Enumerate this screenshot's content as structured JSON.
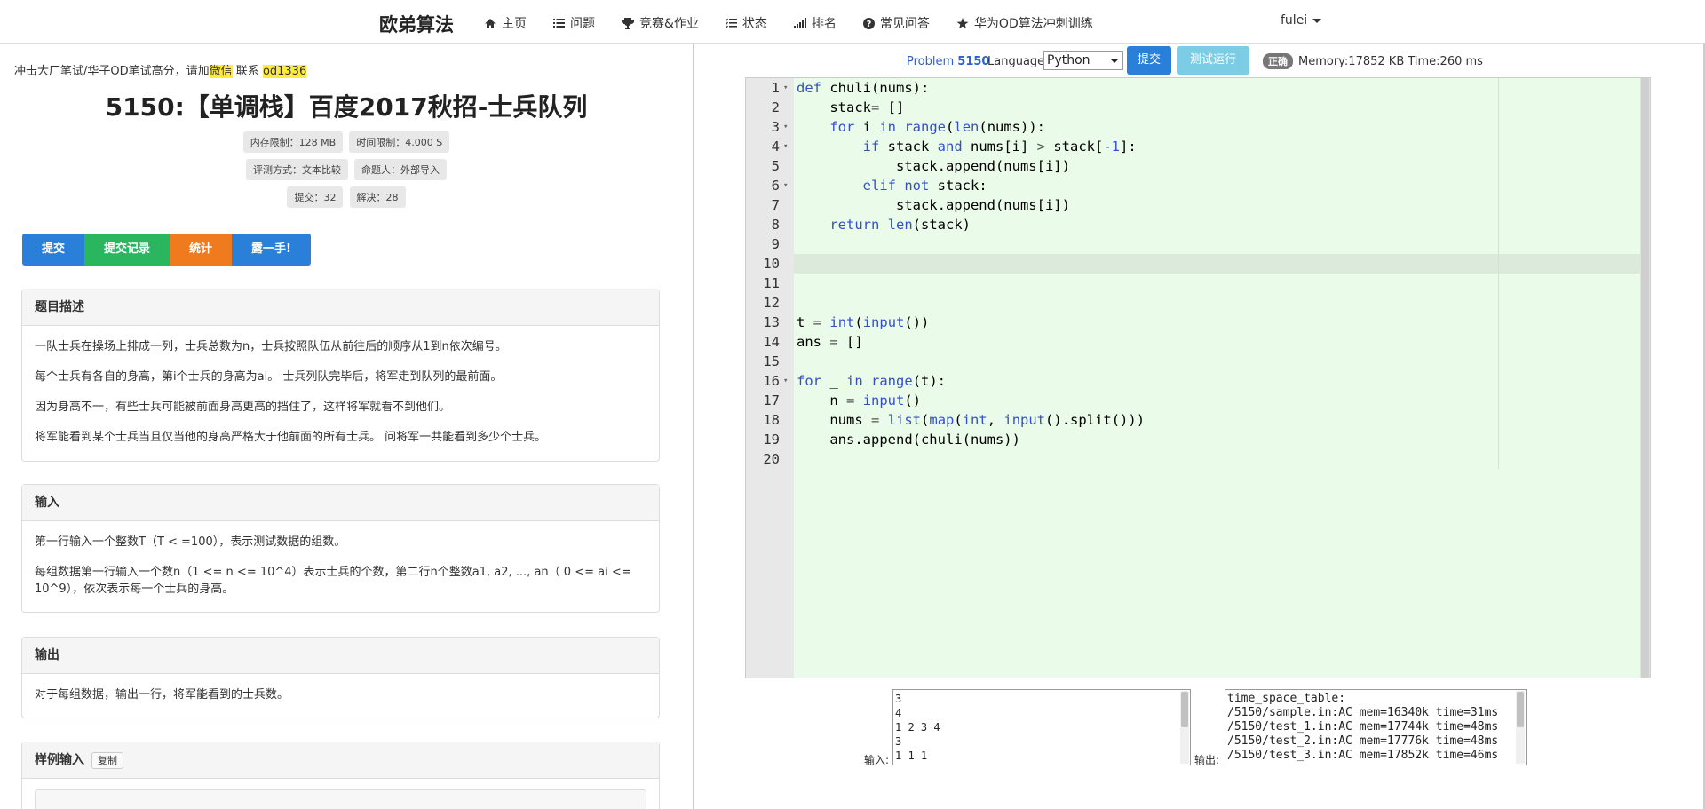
{
  "nav": {
    "brand": "欧弟算法",
    "items": [
      {
        "label": "主页",
        "icon": "home-icon"
      },
      {
        "label": "问题",
        "icon": "list-icon"
      },
      {
        "label": "竞赛&作业",
        "icon": "trophy-icon"
      },
      {
        "label": "状态",
        "icon": "status-list-icon"
      },
      {
        "label": "排名",
        "icon": "bar-chart-icon"
      },
      {
        "label": "常见问答",
        "icon": "question-icon"
      },
      {
        "label": "华为OD算法冲刺训练",
        "icon": "star-icon"
      }
    ],
    "user": "fulei"
  },
  "problem": {
    "promo_prefix": "冲击大厂笔试/华子OD笔试高分，请加",
    "promo_highlight": "微信",
    "promo_middle": "联系",
    "promo_contact": "od1336",
    "title": "5150:【单调栈】百度2017秋招-士兵队列",
    "badges": {
      "memory": "内存限制：128 MB",
      "time": "时间限制：4.000 S",
      "judge": "评测方式：文本比较",
      "author": "命题人：外部导入",
      "submit": "提交：32",
      "solved": "解决：28"
    },
    "buttons": {
      "submit": "提交",
      "records": "提交记录",
      "stats": "统计",
      "show": "露一手!"
    },
    "description_title": "题目描述",
    "description": [
      "一队士兵在操场上排成一列，士兵总数为n，士兵按照队伍从前往后的顺序从1到n依次编号。",
      "每个士兵有各自的身高，第i个士兵的身高为ai。 士兵列队完毕后，将军走到队列的最前面。",
      "因为身高不一，有些士兵可能被前面身高更高的挡住了，这样将军就看不到他们。",
      "将军能看到某个士兵当且仅当他的身高严格大于他前面的所有士兵。 问将军一共能看到多少个士兵。"
    ],
    "input_title": "输入",
    "input": [
      "第一行输入一个整数T（T < =100），表示测试数据的组数。",
      "每组数据第一行输入一个数n（1 <= n <= 10^4）表示士兵的个数，第二行n个整数a1, a2, ..., an（ 0 <= ai <= 10^9），依次表示每一个士兵的身高。"
    ],
    "output_title": "输出",
    "output": "对于每组数据，输出一行，将军能看到的士兵数。",
    "sample_title": "样例输入",
    "copy_label": "复制"
  },
  "toolbar": {
    "problem_prefix": "Problem",
    "problem_id": "5150",
    "language_label": "Language:",
    "language": "Python",
    "submit": "提交",
    "test_run": "测试运行",
    "status": "正确",
    "memory_time": "Memory:17852 KB  Time:260 ms"
  },
  "code": [
    "def chuli(nums):",
    "    stack= []",
    "    for i in range(len(nums)):",
    "        if stack and nums[i] > stack[-1]:",
    "            stack.append(nums[i])",
    "        elif not stack:",
    "            stack.append(nums[i])",
    "    return len(stack)",
    "",
    "",
    "",
    "",
    "t = int(input())",
    "ans = []",
    "",
    "for _ in range(t):",
    "    n = input()",
    "    nums = list(map(int, input().split()))",
    "    ans.append(chuli(nums))",
    ""
  ],
  "fold_lines": [
    1,
    3,
    4,
    6,
    16
  ],
  "io": {
    "input_label": "输入:",
    "output_label": "输出:",
    "input_lines": [
      "3",
      "4",
      "1 2 3 4",
      "3",
      "1 1 1"
    ],
    "output_lines": [
      "time_space_table:",
      "/5150/sample.in:AC mem=16340k time=31ms",
      "/5150/test_1.in:AC mem=17744k time=48ms",
      "/5150/test_2.in:AC mem=17776k time=48ms",
      "/5150/test_3.in:AC mem=17852k time=46ms"
    ]
  },
  "colors": {
    "brand_blue": "#2a80d8",
    "green": "#29b65f",
    "orange": "#f07b1f",
    "editor_bg": "#ebfbe9"
  }
}
